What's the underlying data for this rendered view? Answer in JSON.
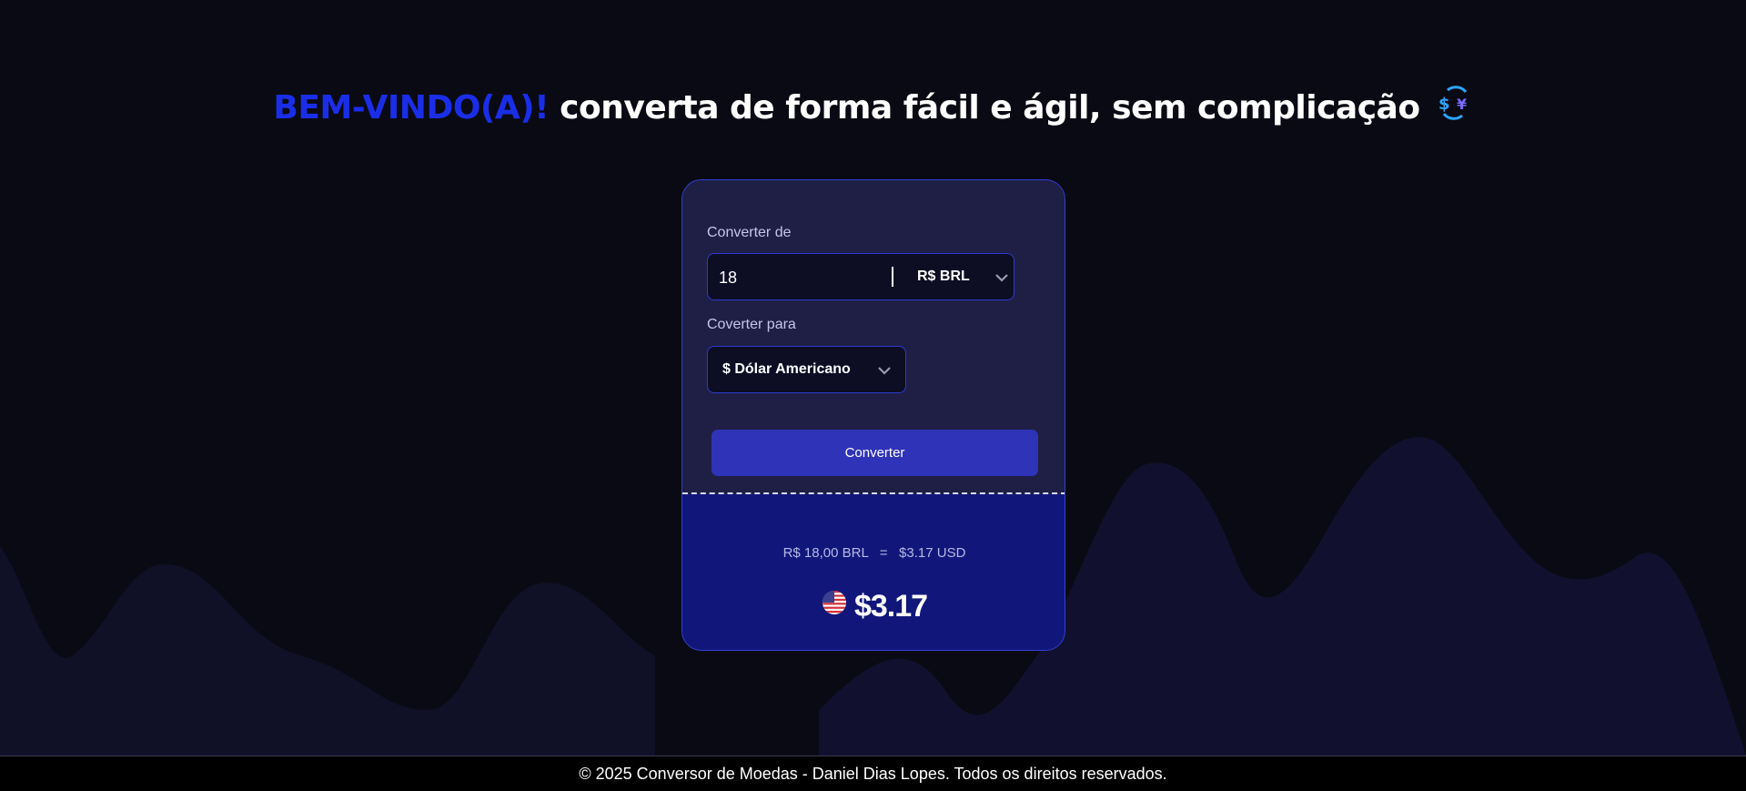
{
  "header": {
    "greeting": "BEM-VINDO(A)!",
    "tagline": "converta de forma fácil e ágil, sem complicação",
    "icon": "currency-swap-icon"
  },
  "converter": {
    "from_label": "Converter de",
    "amount_value": "18",
    "from_currency": "R$ BRL",
    "to_label": "Coverter para",
    "to_currency": "$ Dólar Americano",
    "button_label": "Converter"
  },
  "result": {
    "from_amount": "R$ 18,00 BRL",
    "equals": "=",
    "to_amount": "$3.17 USD",
    "value": "$3.17",
    "flag": "us-flag-icon"
  },
  "footer": {
    "text": "© 2025 Conversor de Moedas - Daniel Dias Lopes. Todos os direitos reservados."
  },
  "colors": {
    "background": "#0a0a14",
    "accent": "#1a2ee8",
    "card": "#1f1f45",
    "result_panel": "#11177a",
    "button": "#2f33b8"
  }
}
